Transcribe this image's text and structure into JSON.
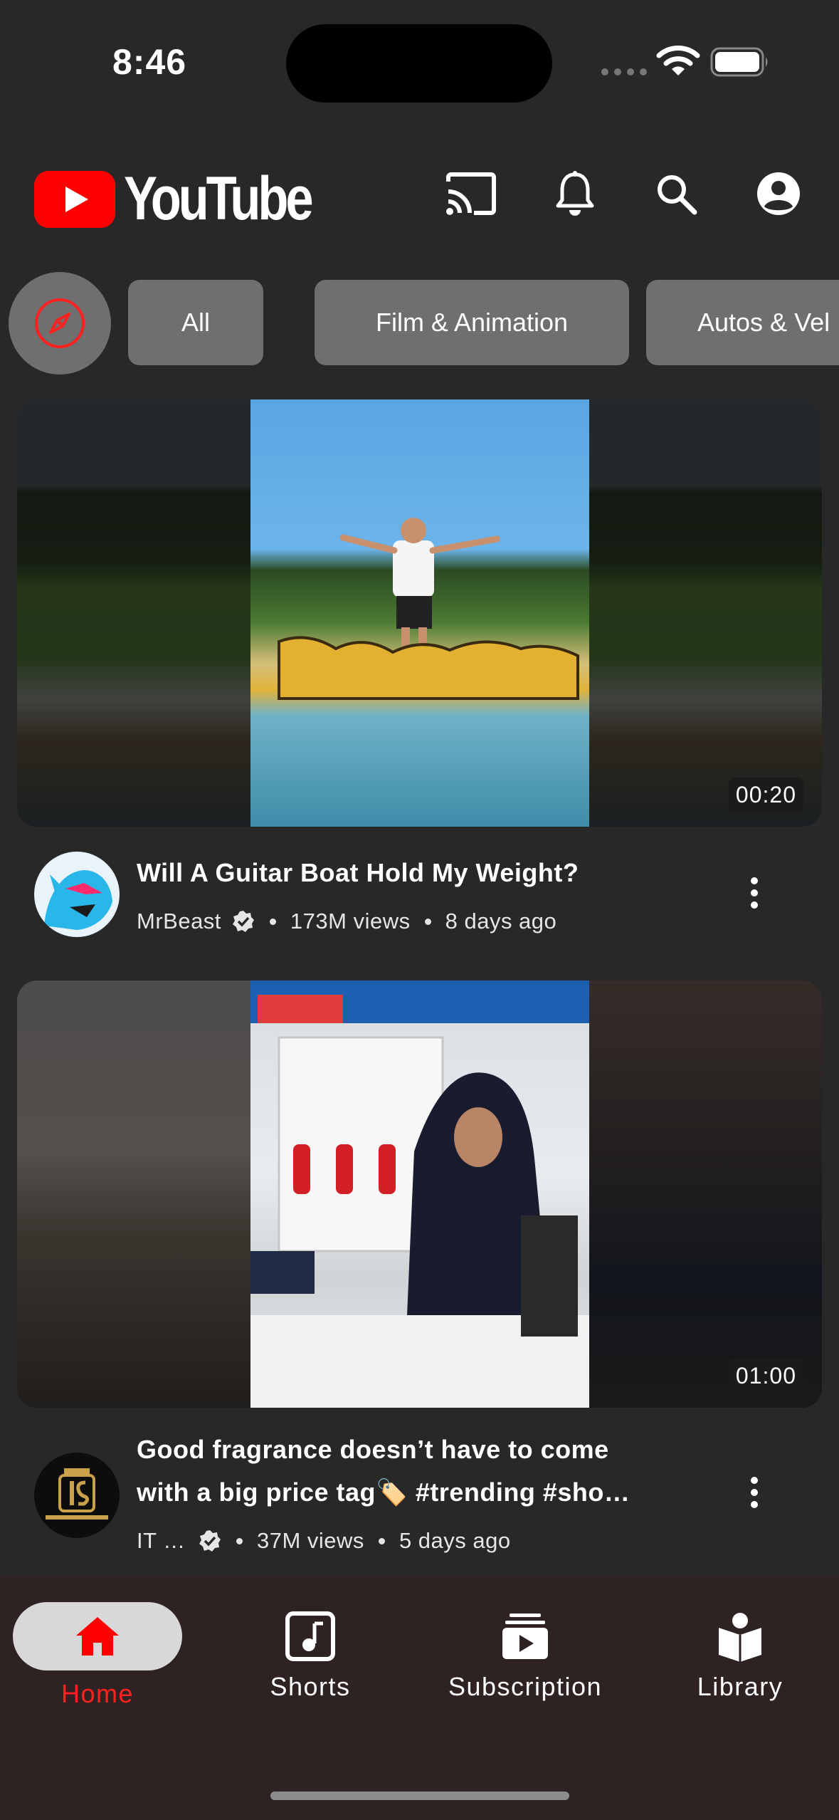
{
  "status_bar": {
    "time": "8:46"
  },
  "header": {
    "logo_text": "YouTube"
  },
  "chips": [
    "All",
    "Film & Animation",
    "Autos & Vel"
  ],
  "videos": [
    {
      "title_line1": "Will A Guitar Boat Hold My Weight?",
      "title_line2": "",
      "channel": "MrBeast",
      "views": "173M views",
      "age": "8 days ago",
      "duration": "00:20"
    },
    {
      "title_line1": "Good fragrance doesn’t have to come",
      "title_line2": "with a big price tag🏷️ #trending #sho…",
      "channel": "IT …",
      "views": "37M views",
      "age": "5 days ago",
      "duration": "01:00"
    }
  ],
  "bottom_nav": {
    "home": "Home",
    "shorts": "Shorts",
    "subscription": "Subscription",
    "library": "Library"
  },
  "colors": {
    "brand_red": "#ff0000",
    "background": "#282828",
    "nav_background": "#2f2223"
  }
}
